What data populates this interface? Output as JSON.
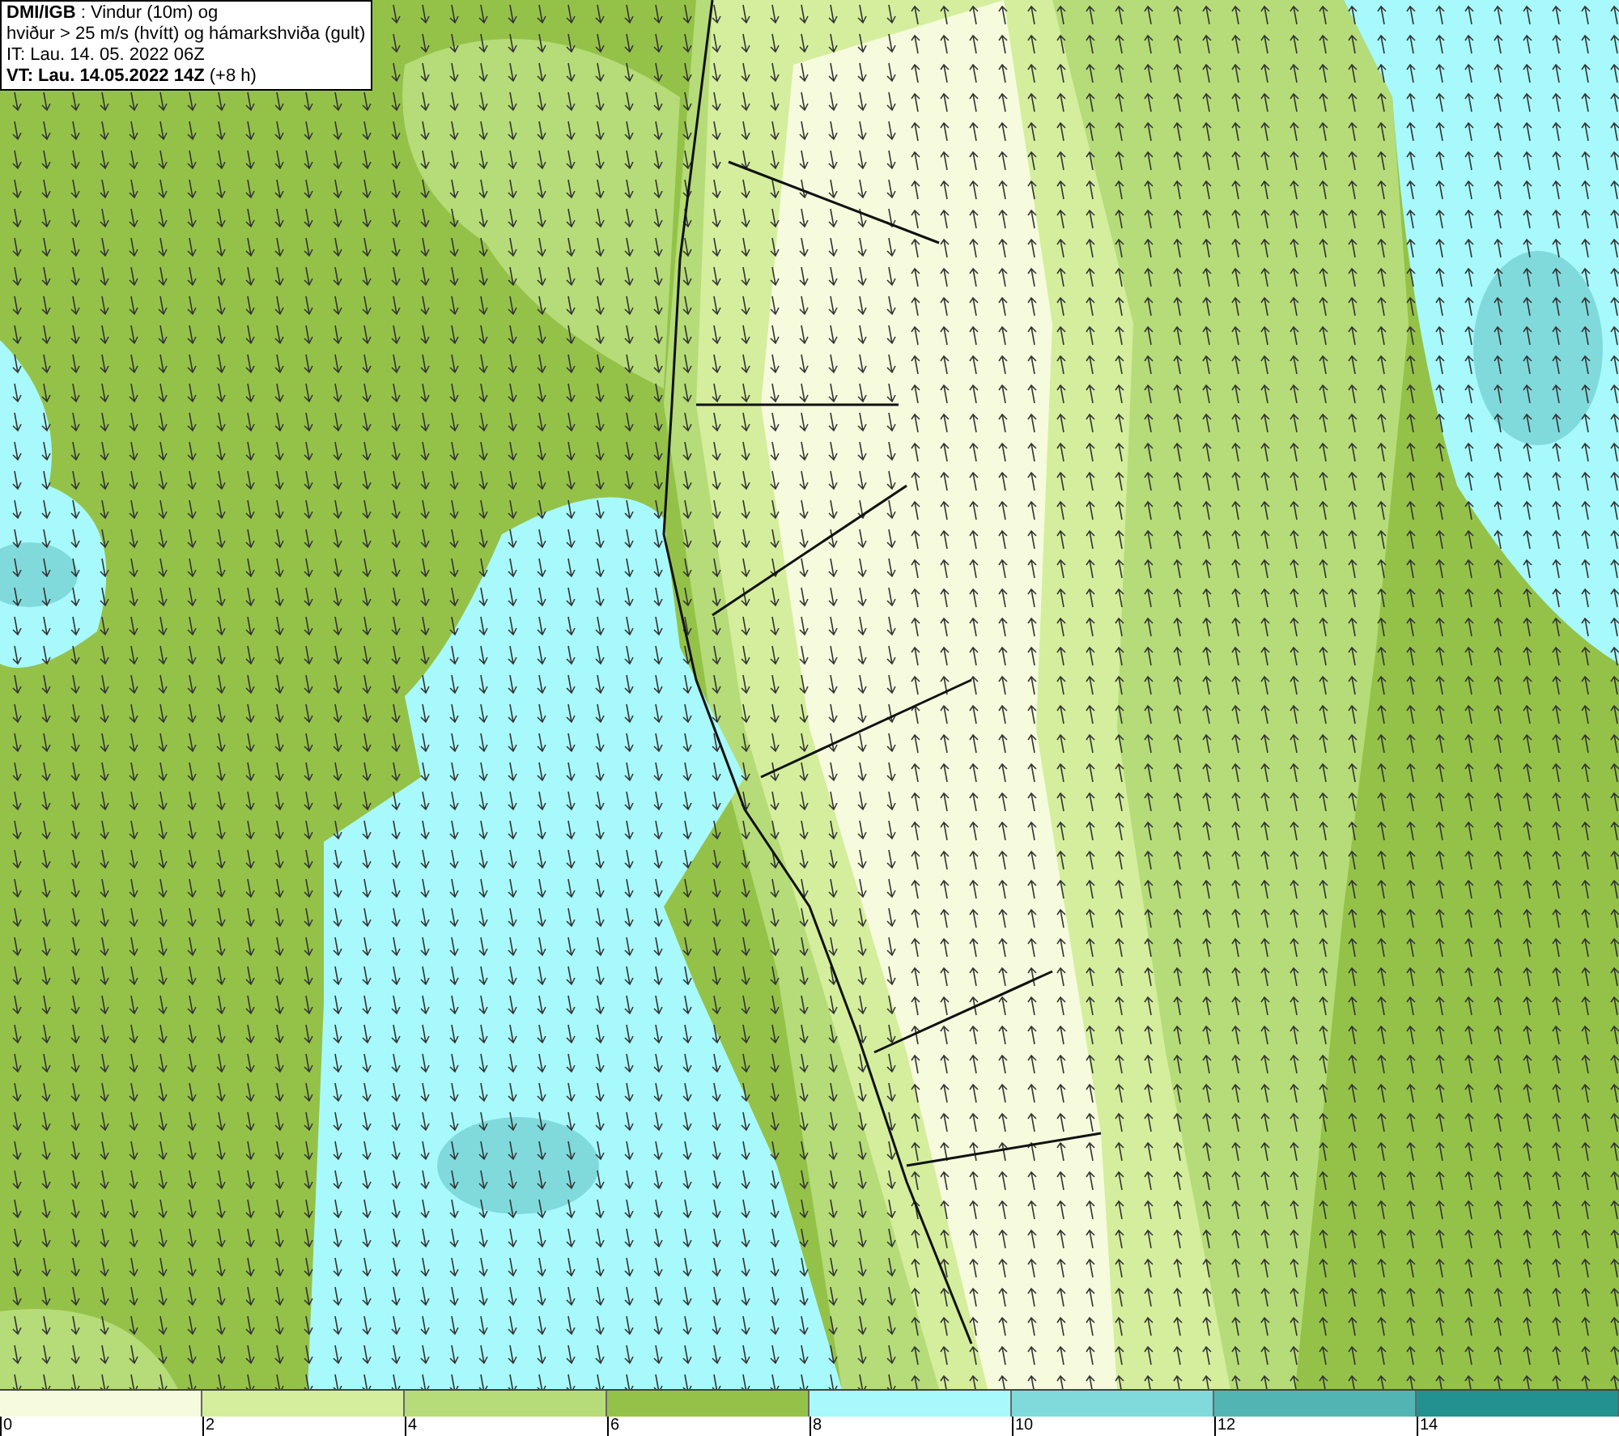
{
  "header": {
    "lines": [
      "**DMI/IGB** : Vindur (10m) og",
      "hviður > 25 m/s (hvítt) og hámarkshviða (gult)",
      "IT: Lau. 14. 05. 2022 06Z",
      "**VT: Lau. 14.05.2022 14Z** (+8 h)"
    ]
  },
  "legend": {
    "bins": [
      {
        "color": "#f5fbdc"
      },
      {
        "color": "#d4ee9d"
      },
      {
        "color": "#b5dc78"
      },
      {
        "color": "#94c249"
      },
      {
        "color": "#a7f9fb"
      },
      {
        "color": "#80dadc"
      },
      {
        "color": "#53b4b4"
      },
      {
        "color": "#23918f"
      }
    ],
    "labels": [
      "0",
      "2",
      "4",
      "6",
      "8",
      "10",
      "12",
      "14"
    ]
  }
}
